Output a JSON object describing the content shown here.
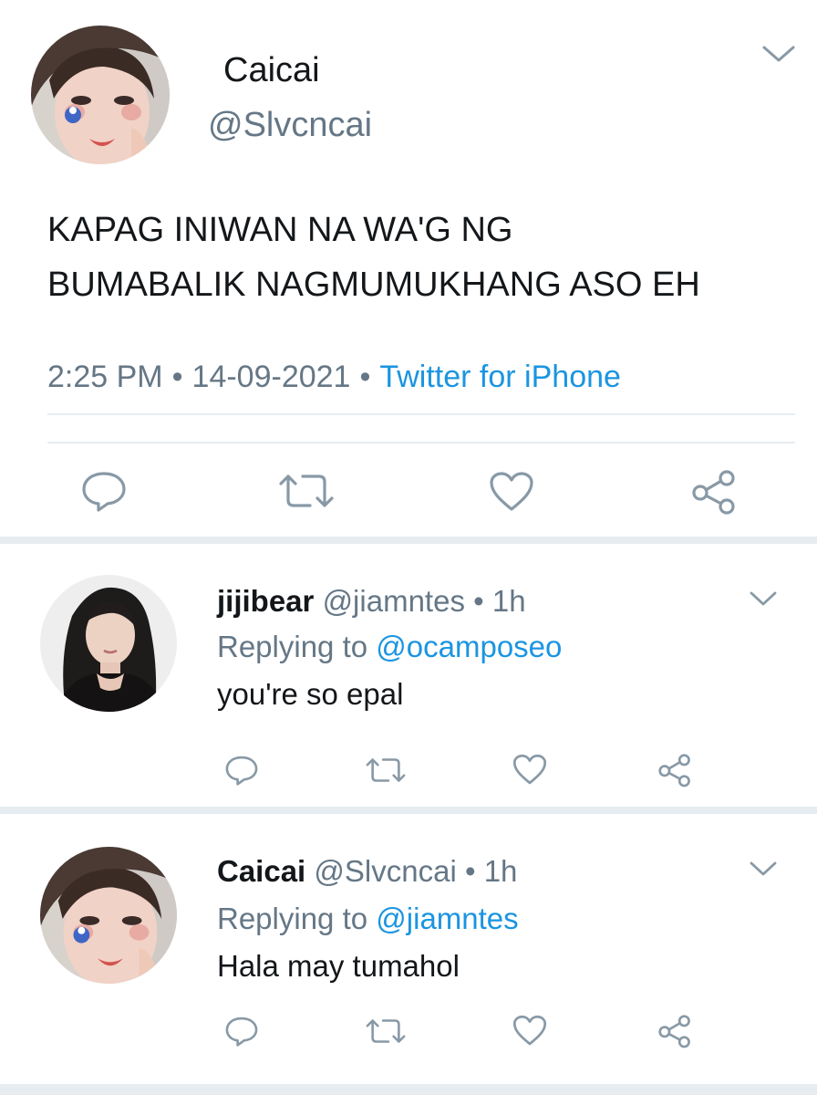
{
  "tweet": {
    "author_name": "Caicai",
    "author_handle": "@Slvcncai",
    "text": "KAPAG INIWAN NA WA'G NG\nBUMABALIK NAGMUMUKHANG ASO EH",
    "time": "2:25 PM",
    "date": "14-09-2021",
    "source": "Twitter for iPhone",
    "separator": "•"
  },
  "replies": [
    {
      "name": "jijibear",
      "handle": "@jiamntes",
      "separator": "•",
      "age": "1h",
      "replying_prefix": "Replying to",
      "replying_to": "@ocamposeo",
      "text": "you're so epal"
    },
    {
      "name": "Caicai",
      "handle": "@Slvcncai",
      "separator": "•",
      "age": "1h",
      "replying_prefix": "Replying to",
      "replying_to": "@jiamntes",
      "text": "Hala may tumahol"
    }
  ],
  "icons": {
    "reply": "reply-icon",
    "retweet": "retweet-icon",
    "like": "heart-icon",
    "share": "share-icon",
    "menu": "chevron-down-icon"
  },
  "colors": {
    "text": "#14171a",
    "secondary": "#657786",
    "link": "#1b95e0",
    "divider": "#e6ecf0"
  }
}
